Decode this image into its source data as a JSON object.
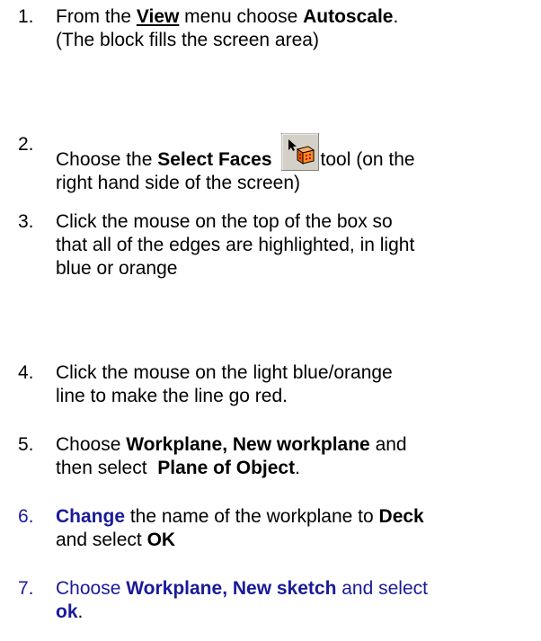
{
  "steps": [
    {
      "number": "1.",
      "parts": [
        {
          "t": "From the ",
          "s": "n"
        },
        {
          "t": "View",
          "s": "bu"
        },
        {
          "t": " menu choose ",
          "s": "n"
        },
        {
          "t": "Autoscale",
          "s": "b"
        },
        {
          "t": ".",
          "s": "n"
        }
      ],
      "line2": "(The block fills the screen area)"
    },
    {
      "number": "2.",
      "pre": "Choose the ",
      "bold": "Select Faces",
      "post": "tool (on the",
      "line2": "right hand side of the screen)",
      "icon": "select-faces-tool-icon"
    },
    {
      "number": "3.",
      "lines": [
        "Click the mouse on the top of the box so",
        "that all of the edges are highlighted, in light",
        "blue or orange"
      ]
    },
    {
      "number": "4.",
      "lines": [
        "Click the mouse on the light blue/orange",
        "line to make the line go red."
      ]
    },
    {
      "number": "5.",
      "pre": "Choose ",
      "bold": "Workplane, New workplane",
      "post": " and",
      "line2_pre": "then select  ",
      "line2_bold": "Plane of Object",
      "line2_post": "."
    },
    {
      "number": "6.",
      "bold1": "Change",
      "mid": " the name of the workplane to ",
      "bold2": "Deck",
      "line2_pre": "and select ",
      "line2_bold": "OK"
    },
    {
      "number": "7.",
      "pre": "Choose ",
      "bold": "Workplane, New sketch",
      "post": " and select",
      "line2_bold": "ok",
      "line2_post": "."
    }
  ],
  "colors": {
    "text": "#000000",
    "blue_steps": "#1a1a99"
  }
}
